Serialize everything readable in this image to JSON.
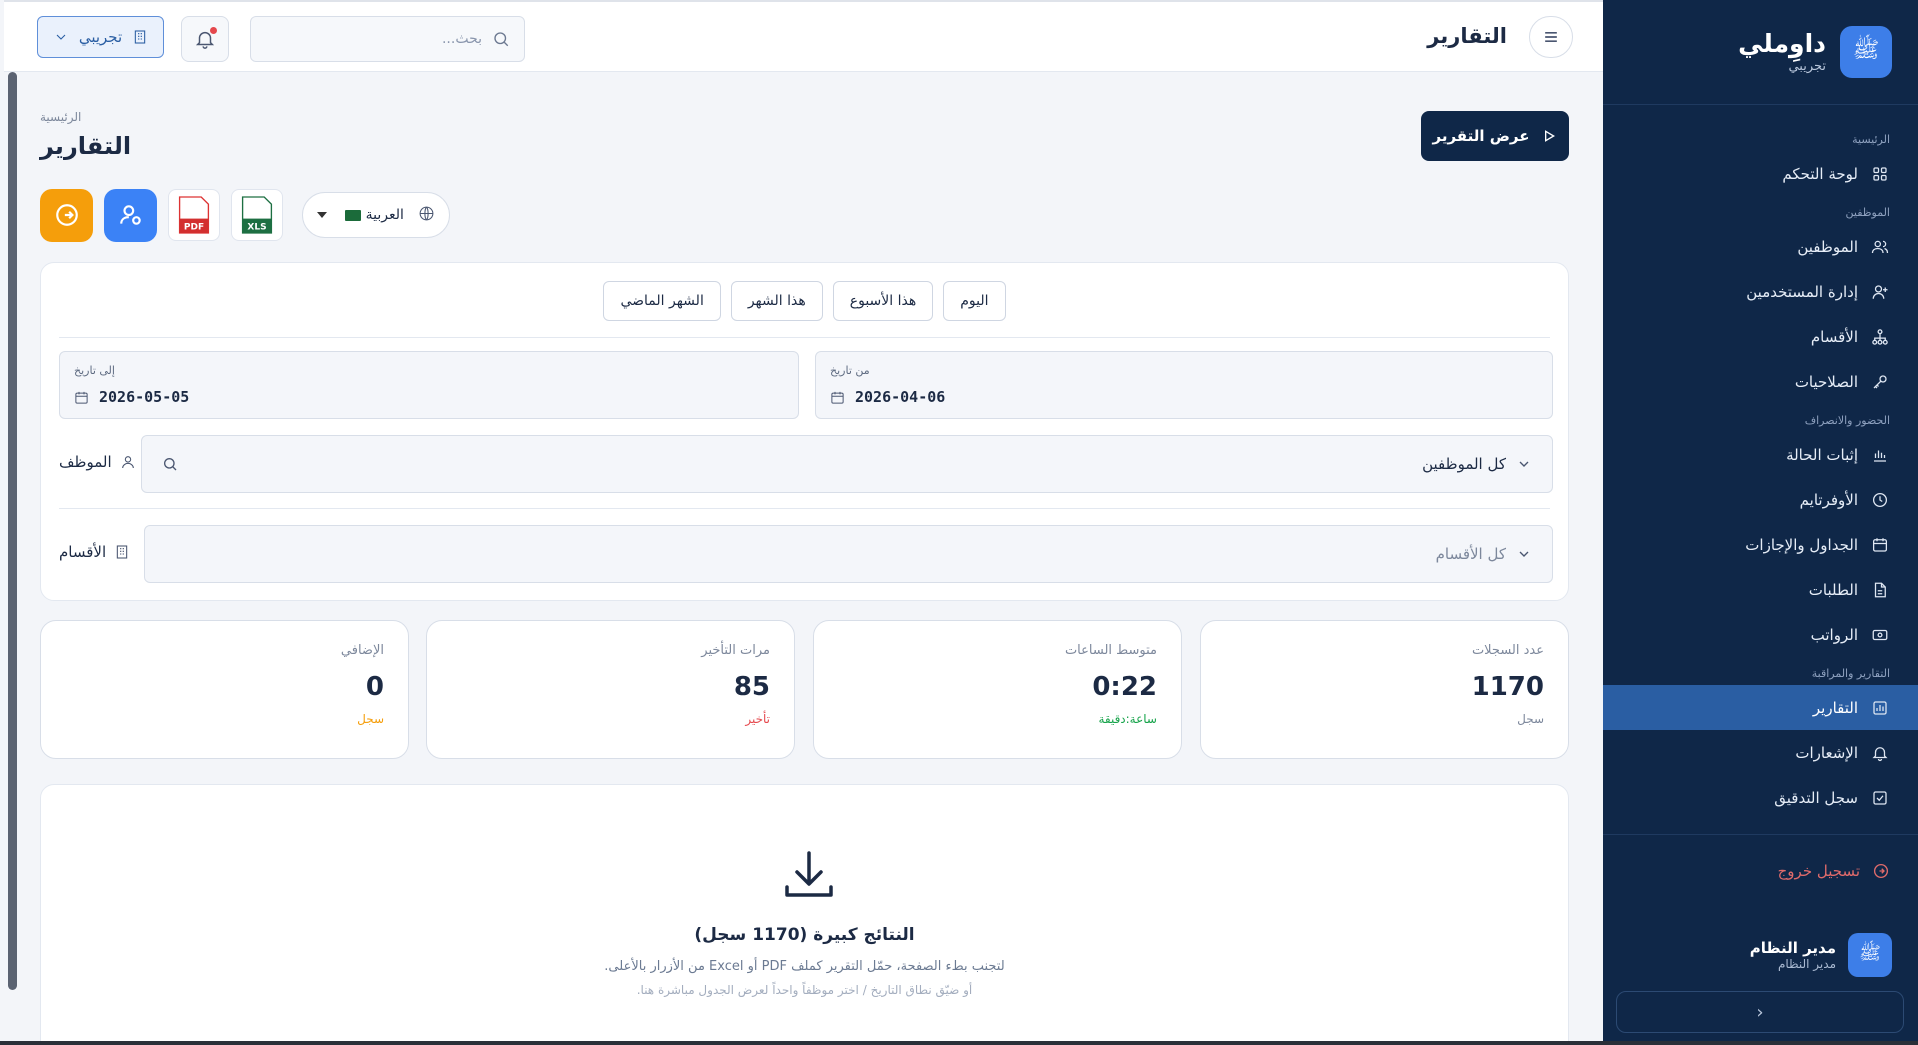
{
  "brand": {
    "name": "داوِملي",
    "subtitle": "تجريبي",
    "logo_text": "ﷺ"
  },
  "sidebar": {
    "sections": [
      {
        "title": "الرئيسية",
        "items": [
          {
            "label": "لوحة التحكم",
            "icon": "grid-icon"
          }
        ]
      },
      {
        "title": "الموظفين",
        "items": [
          {
            "label": "الموظفين",
            "icon": "users-icon"
          },
          {
            "label": "إدارة المستخدمين",
            "icon": "user-plus-icon"
          },
          {
            "label": "الأقسام",
            "icon": "sitemap-icon"
          },
          {
            "label": "الصلاحيات",
            "icon": "key-icon"
          }
        ]
      },
      {
        "title": "الحضور والانصراف",
        "items": [
          {
            "label": "إثبات الحالة",
            "icon": "bar-chart-icon"
          },
          {
            "label": "الأوفرتايم",
            "icon": "clock-icon"
          },
          {
            "label": "الجداول والإجازات",
            "icon": "calendar-icon"
          },
          {
            "label": "الطلبات",
            "icon": "document-icon"
          },
          {
            "label": "الرواتب",
            "icon": "money-icon"
          }
        ]
      },
      {
        "title": "التقارير والمراقبة",
        "items": [
          {
            "label": "التقارير",
            "icon": "report-chart-icon",
            "active": true
          },
          {
            "label": "الإشعارات",
            "icon": "bell-icon"
          },
          {
            "label": "سجل التدقيق",
            "icon": "check-square-icon"
          }
        ]
      }
    ],
    "logout_label": "تسجيل خروج",
    "user": {
      "name": "مدير النظام",
      "role": "مدير النظام"
    },
    "collapse_glyph": "‹"
  },
  "topbar": {
    "title": "التقارير",
    "search_placeholder": "بحث...",
    "tenant_label": "تجريبي"
  },
  "page": {
    "breadcrumb": "الرئيسية",
    "title": "التقارير",
    "view_report_label": "عرض التقرير",
    "language_label": "العربية",
    "export_pdf_label": "PDF",
    "export_xls_label": "XLS"
  },
  "filters": {
    "quick_ranges": [
      "اليوم",
      "هذا الأسبوع",
      "هذا الشهر",
      "الشهر الماضي"
    ],
    "from_label": "من تاريخ",
    "from_value": "2026-04-06",
    "to_label": "إلى تاريخ",
    "to_value": "2026-05-05",
    "employee_label": "الموظف",
    "employee_value": "كل الموظفين",
    "departments_label": "الأقسام",
    "departments_value": "كل الأقسام"
  },
  "stats": [
    {
      "label": "عدد السجلات",
      "value": "1170",
      "unit": "سجل",
      "unit_color": "#7d889c"
    },
    {
      "label": "متوسط الساعات",
      "value": "0:22",
      "unit": "ساعة:دقيقة",
      "unit_color": "#16a34a"
    },
    {
      "label": "مرات التأخير",
      "value": "85",
      "unit": "تأخير",
      "unit_color": "#e5484d"
    },
    {
      "label": "الإضافي",
      "value": "0",
      "unit": "سجل",
      "unit_color": "#f59e0b"
    }
  ],
  "result": {
    "title": "النتائج كبيرة (1170 سجل)",
    "hint": "لتجنب بطء الصفحة، حمّل التقرير كملف PDF أو Excel من الأزرار بالأعلى.",
    "hint2": "أو ضيّق نطاق التاريخ / اختر موظفاً واحداً لعرض الجدول مباشرة هنا."
  },
  "colors": {
    "sidebar_bg": "#0f2748",
    "active_item": "#2a5ea3",
    "accent_orange": "#f59e0b",
    "accent_blue": "#3b82f6"
  }
}
